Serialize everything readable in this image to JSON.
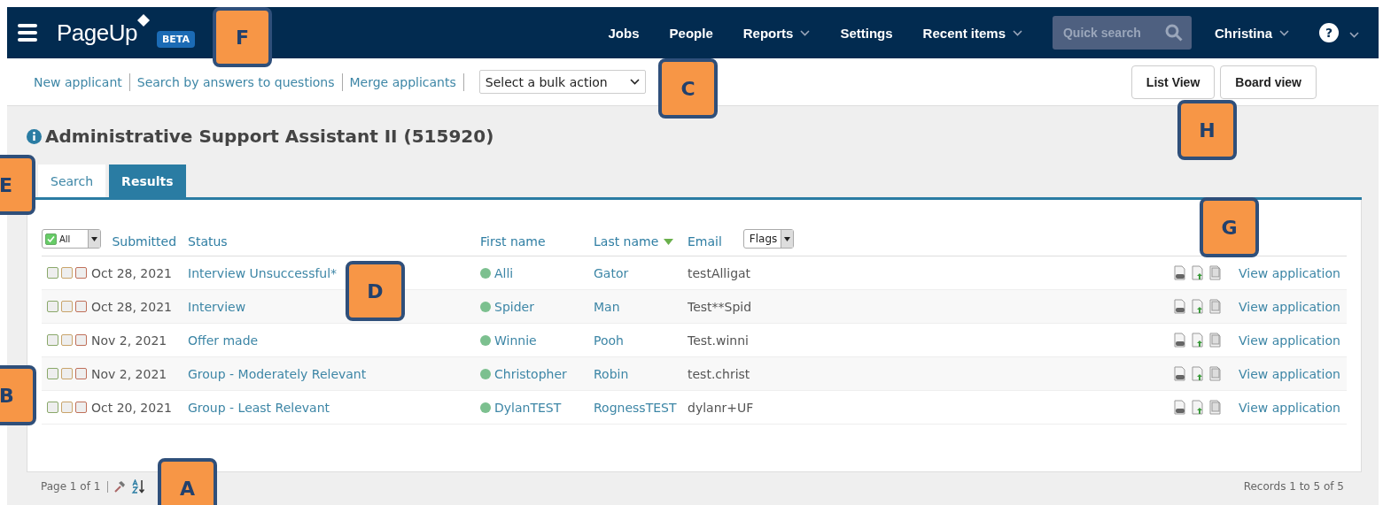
{
  "nav": {
    "brand": "PageUp",
    "badge": "BETA",
    "items": [
      {
        "label": "Jobs",
        "dropdown": false
      },
      {
        "label": "People",
        "dropdown": false
      },
      {
        "label": "Reports",
        "dropdown": true
      },
      {
        "label": "Settings",
        "dropdown": false
      },
      {
        "label": "Recent items",
        "dropdown": true
      }
    ],
    "search": {
      "placeholder": "Quick search"
    },
    "user": "Christina",
    "help": "?"
  },
  "toolbar": {
    "links": [
      "New applicant",
      "Search by answers to questions",
      "Merge applicants"
    ],
    "bulk_select": "Select a bulk action",
    "view_buttons": [
      "List View",
      "Board view"
    ]
  },
  "title": "Administrative Support Assistant II (515920)",
  "tabs": [
    {
      "label": "Search",
      "selected": false
    },
    {
      "label": "Results",
      "selected": true
    }
  ],
  "table": {
    "select_all": {
      "label": "All",
      "checked": true
    },
    "columns": [
      {
        "label": "Submitted",
        "sorted": false
      },
      {
        "label": "Status",
        "sorted": false
      },
      {
        "label": "First name",
        "sorted": false
      },
      {
        "label": "Last name",
        "sorted": true
      },
      {
        "label": "Email",
        "sorted": false
      }
    ],
    "flags_filter": "Flags",
    "rows": [
      {
        "checks": [
          {
            "color": "#8aa86a",
            "checked": false
          },
          {
            "color": "#c9a46a",
            "checked": false
          },
          {
            "color": "#c0705a",
            "checked": false
          }
        ],
        "submitted": "Oct 28, 2021",
        "status": "Interview Unsuccessful*",
        "color": "#7cc08f",
        "first_name": "Alli",
        "last_name": "Gator",
        "email": "testAlligat",
        "action": "View application"
      },
      {
        "checks": [
          {
            "color": "#8aa86a",
            "checked": false
          },
          {
            "color": "#c9a46a",
            "checked": false
          },
          {
            "color": "#c0705a",
            "checked": false
          }
        ],
        "submitted": "Oct 28, 2021",
        "status": "Interview",
        "color": "#7cc08f",
        "first_name": "Spider",
        "last_name": "Man",
        "email": "Test**Spid",
        "action": "View application"
      },
      {
        "checks": [
          {
            "color": "#8aa86a",
            "checked": false
          },
          {
            "color": "#c9a46a",
            "checked": false
          },
          {
            "color": "#c0705a",
            "checked": false
          }
        ],
        "submitted": "Nov 2, 2021",
        "status": "Offer made",
        "color": "#7cc08f",
        "first_name": "Winnie",
        "last_name": "Pooh",
        "email": "Test.winni",
        "action": "View application"
      },
      {
        "checks": [
          {
            "color": "#8aa86a",
            "checked": false
          },
          {
            "color": "#c9a46a",
            "checked": false
          },
          {
            "color": "#c0705a",
            "checked": false
          }
        ],
        "submitted": "Nov 2, 2021",
        "status": "Group - Moderately Relevant",
        "color": "#7cc08f",
        "first_name": "Christopher",
        "last_name": "Robin",
        "email": "test.christ",
        "action": "View application"
      },
      {
        "checks": [
          {
            "color": "#8aa86a",
            "checked": false
          },
          {
            "color": "#c9a46a",
            "checked": false
          },
          {
            "color": "#c0705a",
            "checked": false
          }
        ],
        "submitted": "Oct 20, 2021",
        "status": "Group - Least Relevant",
        "color": "#7cc08f",
        "first_name": "DylanTEST",
        "last_name": "RognessTEST",
        "email": "dylanr+UF",
        "action": "View application"
      }
    ]
  },
  "footer": {
    "page": "Page 1 of 1",
    "records": "Records 1 to 5 of 5"
  },
  "callouts": [
    "F",
    "C",
    "H",
    "E",
    "G",
    "D",
    "B",
    "A"
  ]
}
